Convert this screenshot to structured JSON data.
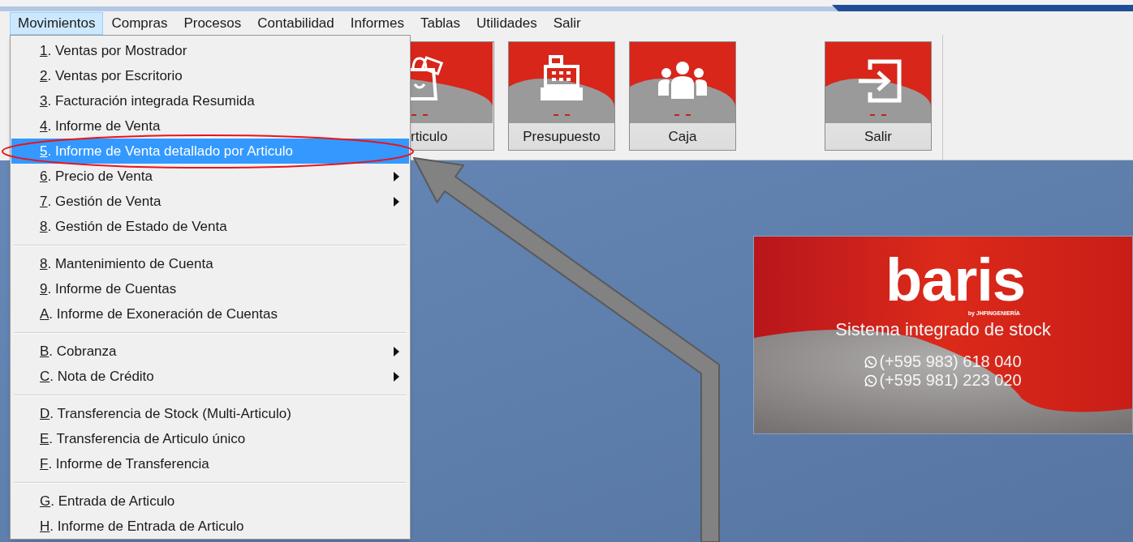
{
  "menu_bar": [
    {
      "label": "Movimientos",
      "selected": true
    },
    {
      "label": "Compras",
      "selected": false
    },
    {
      "label": "Procesos",
      "selected": false
    },
    {
      "label": "Contabilidad",
      "selected": false
    },
    {
      "label": "Informes",
      "selected": false
    },
    {
      "label": "Tablas",
      "selected": false
    },
    {
      "label": "Utilidades",
      "selected": false
    },
    {
      "label": "Salir",
      "selected": false
    }
  ],
  "dropdown": {
    "items": [
      {
        "kind": "item",
        "label": "1. Ventas por Mostrador",
        "selected": false,
        "submenu": false
      },
      {
        "kind": "item",
        "label": "2. Ventas por Escritorio",
        "selected": false,
        "submenu": false
      },
      {
        "kind": "item",
        "label": "3. Facturación integrada Resumida",
        "selected": false,
        "submenu": false
      },
      {
        "kind": "item",
        "label": "4. Informe de Venta",
        "selected": false,
        "submenu": false
      },
      {
        "kind": "item",
        "label": "5. Informe de Venta detallado por Articulo",
        "selected": true,
        "submenu": false
      },
      {
        "kind": "item",
        "label": "6. Precio de Venta",
        "selected": false,
        "submenu": true
      },
      {
        "kind": "item",
        "label": "7. Gestión de Venta",
        "selected": false,
        "submenu": true
      },
      {
        "kind": "item",
        "label": "8. Gestión de Estado de Venta",
        "selected": false,
        "submenu": false
      },
      {
        "kind": "separator"
      },
      {
        "kind": "item",
        "label": "8. Mantenimiento de Cuenta",
        "selected": false,
        "submenu": false
      },
      {
        "kind": "item",
        "label": "9. Informe de Cuentas",
        "selected": false,
        "submenu": false
      },
      {
        "kind": "item",
        "label": "A. Informe de Exoneración de Cuentas",
        "selected": false,
        "submenu": false
      },
      {
        "kind": "separator"
      },
      {
        "kind": "item",
        "label": "B. Cobranza",
        "selected": false,
        "submenu": true
      },
      {
        "kind": "item",
        "label": "C. Nota de Crédito",
        "selected": false,
        "submenu": true
      },
      {
        "kind": "separator"
      },
      {
        "kind": "item",
        "label": "D. Transferencia de Stock (Multi-Articulo)",
        "selected": false,
        "submenu": false
      },
      {
        "kind": "item",
        "label": "E. Transferencia de Articulo único",
        "selected": false,
        "submenu": false
      },
      {
        "kind": "item",
        "label": "F. Informe de Transferencia",
        "selected": false,
        "submenu": false
      },
      {
        "kind": "separator"
      },
      {
        "kind": "item",
        "label": "G. Entrada de Articulo",
        "selected": false,
        "submenu": false
      },
      {
        "kind": "item",
        "label": "H. Informe de Entrada de Articulo",
        "selected": false,
        "submenu": false
      }
    ]
  },
  "toolbar": {
    "buttons": [
      {
        "label": "rticulo"
      },
      {
        "label": "Presupuesto"
      },
      {
        "label": "Caja"
      },
      {
        "label": "Salir"
      }
    ]
  },
  "splash": {
    "logo": "baris",
    "byline": "by JHFINGENIERÍA",
    "tagline": "Sistema integrado de stock",
    "phones": [
      "(+595 983) 618 040",
      "(+595 981) 223 020"
    ]
  }
}
